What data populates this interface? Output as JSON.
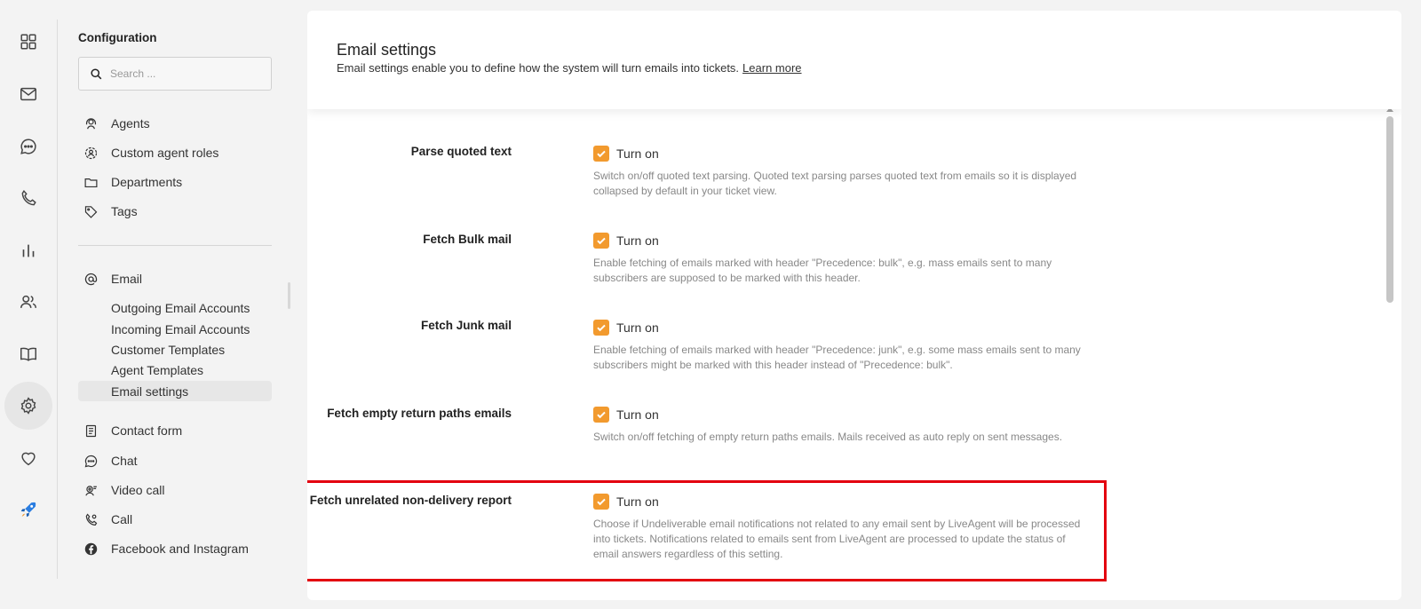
{
  "rail": {
    "items": [
      {
        "icon": "dashboard-icon"
      },
      {
        "icon": "mail-icon"
      },
      {
        "icon": "chat-icon"
      },
      {
        "icon": "phone-icon"
      },
      {
        "icon": "reports-icon"
      },
      {
        "icon": "contacts-icon"
      },
      {
        "icon": "knowledgebase-icon"
      },
      {
        "icon": "settings-icon",
        "active": true
      },
      {
        "icon": "heart-icon"
      },
      {
        "icon": "rocket-icon"
      }
    ]
  },
  "config": {
    "title": "Configuration",
    "search_placeholder": "Search ...",
    "top_items": [
      {
        "label": "Agents",
        "icon": "agent-headset-icon"
      },
      {
        "label": "Custom agent roles",
        "icon": "agent-roles-icon"
      },
      {
        "label": "Departments",
        "icon": "folder-icon"
      },
      {
        "label": "Tags",
        "icon": "tag-icon"
      }
    ],
    "email_section": {
      "label": "Email",
      "icon": "at-sign-icon",
      "sub_items": [
        {
          "label": "Outgoing Email Accounts"
        },
        {
          "label": "Incoming Email Accounts"
        },
        {
          "label": "Customer Templates"
        },
        {
          "label": "Agent Templates"
        },
        {
          "label": "Email settings",
          "active": true
        }
      ]
    },
    "bottom_items": [
      {
        "label": "Contact form",
        "icon": "form-icon"
      },
      {
        "label": "Chat",
        "icon": "chat-bubble-icon"
      },
      {
        "label": "Video call",
        "icon": "video-call-icon"
      },
      {
        "label": "Call",
        "icon": "phone-settings-icon"
      },
      {
        "label": "Facebook and Instagram",
        "icon": "facebook-icon"
      }
    ]
  },
  "main": {
    "title": "Email settings",
    "description": "Email settings enable you to define how the system will turn emails into tickets.",
    "learn_more": "Learn more",
    "settings": [
      {
        "label": "Parse quoted text",
        "checkbox_label": "Turn on",
        "checked": true,
        "help": "Switch on/off quoted text parsing. Quoted text parsing parses quoted text from emails so it is displayed collapsed by default in your ticket view."
      },
      {
        "label": "Fetch Bulk mail",
        "checkbox_label": "Turn on",
        "checked": true,
        "help": "Enable fetching of emails marked with header \"Precedence: bulk\", e.g. mass emails sent to many subscribers are supposed to be marked with this header."
      },
      {
        "label": "Fetch Junk mail",
        "checkbox_label": "Turn on",
        "checked": true,
        "help": "Enable fetching of emails marked with header \"Precedence: junk\", e.g. some mass emails sent to many subscribers might be marked with this header instead of \"Precedence: bulk\"."
      },
      {
        "label": "Fetch empty return paths emails",
        "checkbox_label": "Turn on",
        "checked": true,
        "help": "Switch on/off fetching of empty return paths emails. Mails received as auto reply on sent messages."
      },
      {
        "label": "Fetch unrelated non-delivery report",
        "checkbox_label": "Turn on",
        "checked": true,
        "highlighted": true,
        "help": "Choose if Undeliverable email notifications not related to any email sent by LiveAgent will be processed into tickets. Notifications related to emails sent from LiveAgent are processed to update the status of email answers regardless of this setting."
      }
    ]
  },
  "colors": {
    "accent": "#f29a2e",
    "highlight": "#e3000f"
  }
}
